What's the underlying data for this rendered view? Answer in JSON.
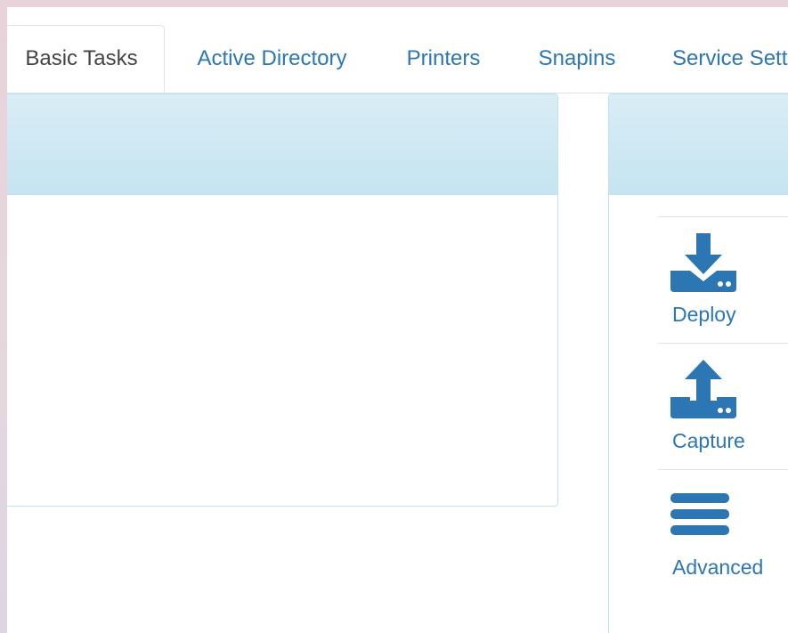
{
  "tabs": [
    {
      "label": "Basic Tasks",
      "active": true
    },
    {
      "label": "Active Directory",
      "active": false
    },
    {
      "label": "Printers",
      "active": false
    },
    {
      "label": "Snapins",
      "active": false
    },
    {
      "label": "Service Settings",
      "active": false
    }
  ],
  "tasks": [
    {
      "label": "Deploy",
      "icon": "download-drive-icon"
    },
    {
      "label": "Capture",
      "icon": "upload-drive-icon"
    },
    {
      "label": "Advanced",
      "icon": "bars-icon"
    }
  ],
  "colors": {
    "accent": "#2c76b4",
    "panel_header": "#c6e4f1",
    "panel_border": "#bfe3ee"
  }
}
